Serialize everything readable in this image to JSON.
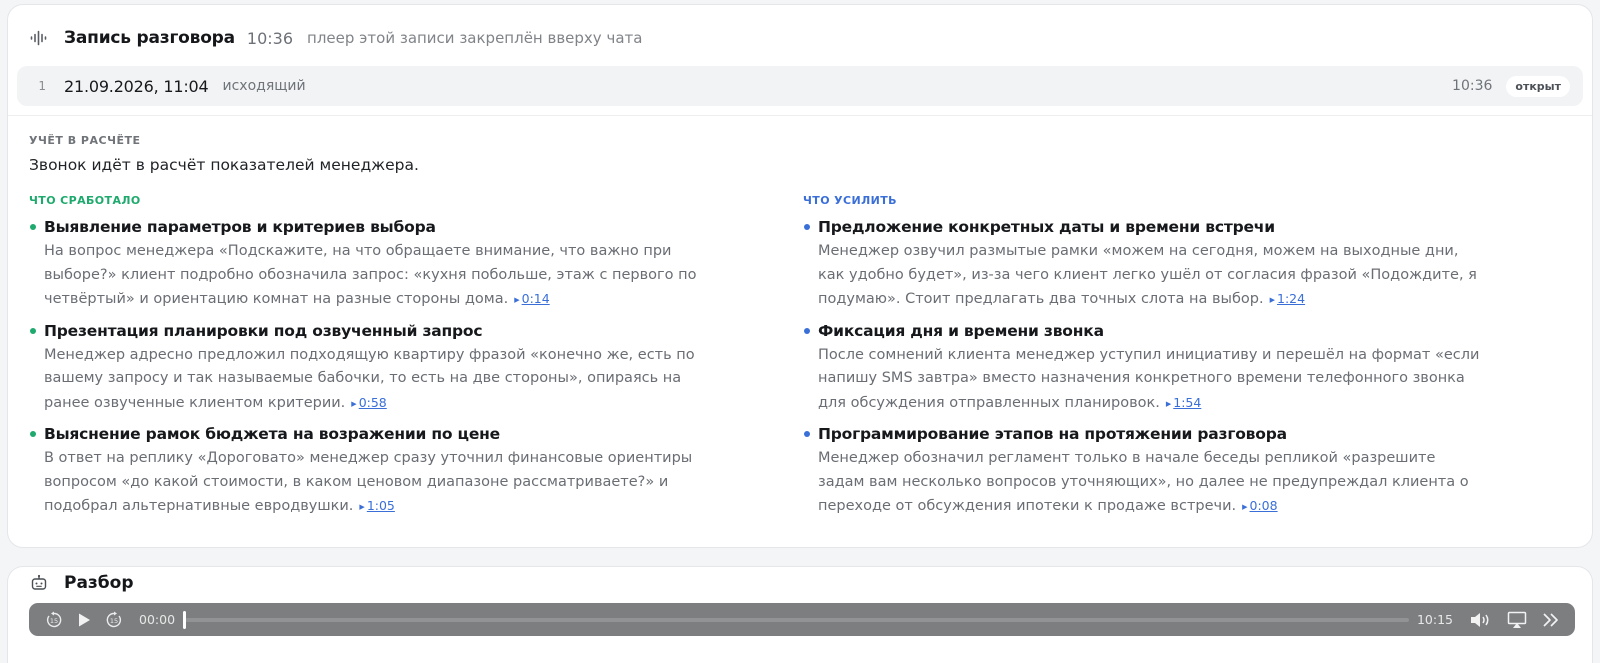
{
  "recording": {
    "title": "Запись разговора",
    "duration": "10:36",
    "note": "плеер этой записи закреплён вверху чата"
  },
  "call": {
    "index": "1",
    "datetime": "21.09.2026, 11:04",
    "direction": "исходящий",
    "duration": "10:36",
    "status": "открыт"
  },
  "calculation": {
    "label": "УЧЁТ В РАСЧЁТЕ",
    "text": "Звонок идёт в расчёт показателей менеджера."
  },
  "worked": {
    "label": "ЧТО СРАБОТАЛО",
    "items": [
      {
        "title": "Выявление параметров и критериев выбора",
        "text": "На вопрос менеджера «Подскажите, на что обращаете внимание, что важно при выборе?» клиент подробно обозначила запрос: «кухня побольше, этаж с первого по четвёртый» и ориентацию комнат на разные стороны дома.",
        "timestamp": "0:14"
      },
      {
        "title": "Презентация планировки под озвученный запрос",
        "text": "Менеджер адресно предложил подходящую квартиру фразой «конечно же, есть по вашему запросу и так называемые бабочки, то есть на две стороны», опираясь на ранее озвученные клиентом критерии.",
        "timestamp": "0:58"
      },
      {
        "title": "Выяснение рамок бюджета на возражении по цене",
        "text": "В ответ на реплику «Дороговато» менеджер сразу уточнил финансовые ориентиры вопросом «до какой стоимости, в каком ценовом диапазоне рассматриваете?» и подобрал альтернативные евродвушки.",
        "timestamp": "1:05"
      }
    ]
  },
  "improve": {
    "label": "ЧТО УСИЛИТЬ",
    "items": [
      {
        "title": "Предложение конкретных даты и времени встречи",
        "text": "Менеджер озвучил размытые рамки «можем на сегодня, можем на выходные дни, как удобно будет», из-за чего клиент легко ушёл от согласия фразой «Подождите, я подумаю». Стоит предлагать два точных слота на выбор.",
        "timestamp": "1:24"
      },
      {
        "title": "Фиксация дня и времени звонка",
        "text": "После сомнений клиента менеджер уступил инициативу и перешёл на формат «если напишу SMS завтра» вместо назначения конкретного времени телефонного звонка для обсуждения отправленных планировок.",
        "timestamp": "1:54"
      },
      {
        "title": "Программирование этапов на протяжении разговора",
        "text": "Менеджер обозначил регламент только в начале беседы репликой «разрешите задам вам несколько вопросов уточняющих», но далее не предупреждал клиента о переходе от обсуждения ипотеки к продаже встречи.",
        "timestamp": "0:08"
      }
    ]
  },
  "analysis": {
    "title": "Разбор"
  },
  "player": {
    "current": "00:00",
    "total": "10:15",
    "progress": 0,
    "icons": [
      "skip-back-15-icon",
      "play-icon",
      "skip-forward-15-icon",
      "volume-icon",
      "airplay-icon",
      "more-icon"
    ]
  },
  "colors": {
    "accent_green": "#1eaa6c",
    "accent_blue": "#3a6fd8",
    "player_bg": "#7d7e80"
  }
}
